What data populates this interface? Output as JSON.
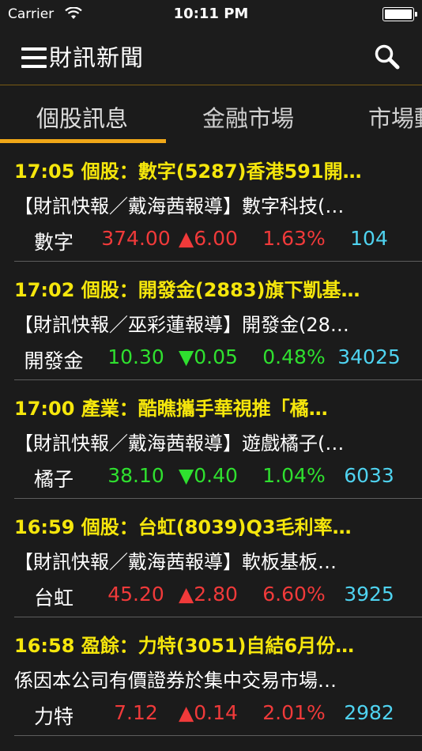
{
  "status_bar": {
    "carrier": "Carrier",
    "time": "10:11 PM"
  },
  "nav": {
    "title": "財訊新聞",
    "menu_icon": "hamburger-menu-icon",
    "search_icon": "search-icon"
  },
  "tabs": [
    {
      "label": "個股訊息",
      "active": true
    },
    {
      "label": "金融市場",
      "active": false
    },
    {
      "label": "市場動",
      "active": false
    }
  ],
  "colors": {
    "headline": "#f5e60c",
    "up": "#f03a3a",
    "down": "#2fe02f",
    "volume": "#4fd3f0",
    "accent": "#f0a818"
  },
  "news": [
    {
      "headline": "17:05 個股：數字(5287)香港591開…",
      "summary": "【財訊快報／戴海茜報導】數字科技(…",
      "quote": {
        "name": "數字",
        "price": "374.00",
        "change": "▲6.00",
        "pct": "1.63%",
        "volume": "104",
        "direction": "up"
      }
    },
    {
      "headline": "17:02 個股：開發金(2883)旗下凱基…",
      "summary": "【財訊快報／巫彩蓮報導】開發金(28…",
      "quote": {
        "name": "開發金",
        "price": "10.30",
        "change": "▼0.05",
        "pct": "0.48%",
        "volume": "34025",
        "direction": "down"
      }
    },
    {
      "headline": "17:00 產業：酷瞧攜手華視推「橘…",
      "summary": "【財訊快報／戴海茜報導】遊戲橘子(…",
      "quote": {
        "name": "橘子",
        "price": "38.10",
        "change": "▼0.40",
        "pct": "1.04%",
        "volume": "6033",
        "direction": "down"
      }
    },
    {
      "headline": "16:59 個股：台虹(8039)Q3毛利率…",
      "summary": "【財訊快報／戴海茜報導】軟板基板…",
      "quote": {
        "name": "台虹",
        "price": "45.20",
        "change": "▲2.80",
        "pct": "6.60%",
        "volume": "3925",
        "direction": "up"
      }
    },
    {
      "headline": "16:58 盈餘：力特(3051)自結6月份…",
      "summary": "係因本公司有價證券於集中交易市場…",
      "quote": {
        "name": "力特",
        "price": "7.12",
        "change": "▲0.14",
        "pct": "2.01%",
        "volume": "2982",
        "direction": "up"
      }
    }
  ]
}
